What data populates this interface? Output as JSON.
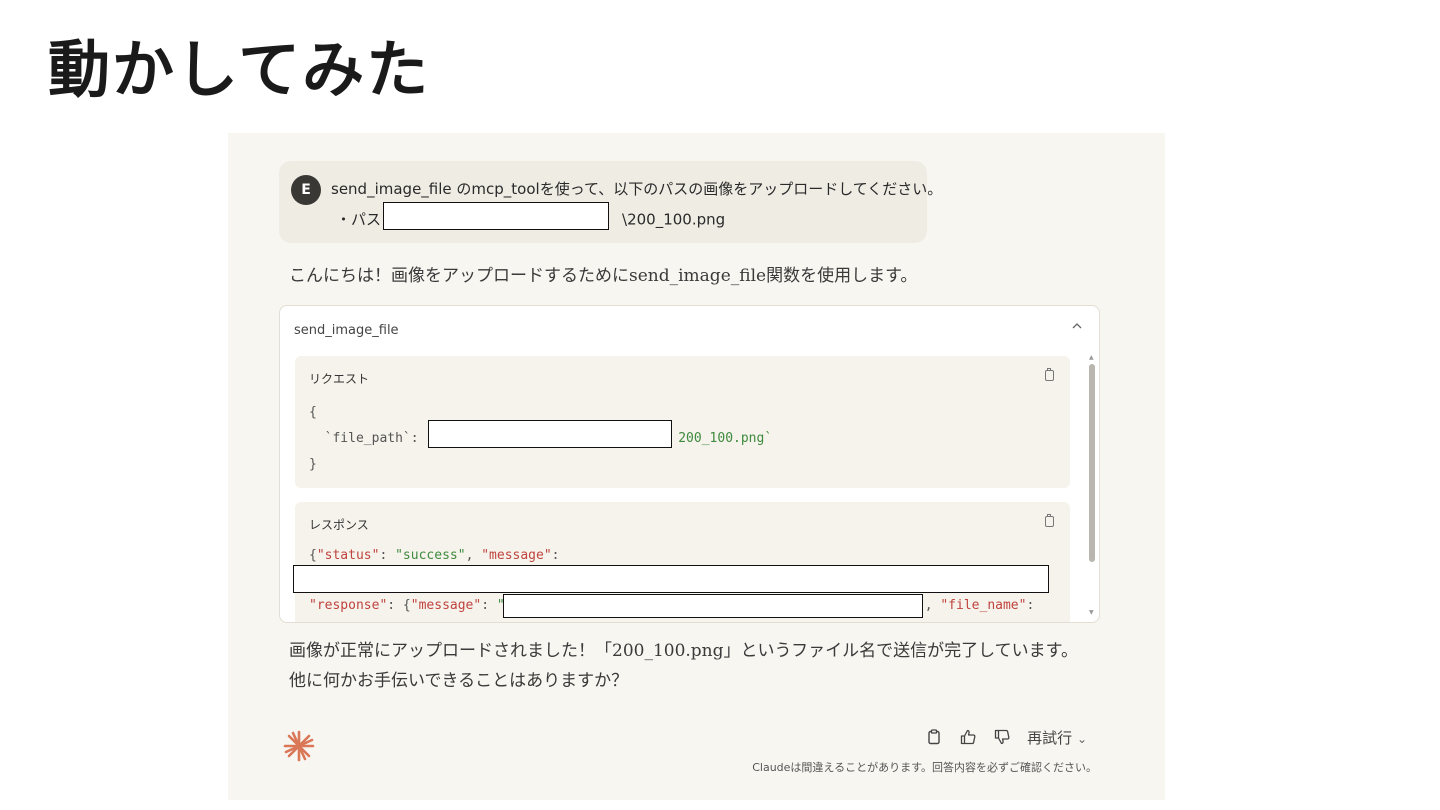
{
  "slide": {
    "title": "動かしてみた"
  },
  "chat": {
    "user_message": {
      "avatar_letter": "E",
      "line1": "send_image_file のmcp_toolを使って、以下のパスの画像をアップロードしてください。",
      "line2_prefix": "・パス：",
      "line2_suffix": "\\200_100.png"
    },
    "assistant_intro": "こんにちは！画像をアップロードするためにsend_image_file関数を使用します。",
    "tool_call": {
      "name": "send_image_file",
      "request": {
        "label": "リクエスト",
        "open_brace": "{",
        "key": "`file_path`",
        "colon": ": ",
        "value_prefix": "`",
        "value_suffix": "200_100.png`",
        "close_brace": "}"
      },
      "response": {
        "label": "レスポンス",
        "line1_open": "{",
        "status_key": "\"status\"",
        "status_value": "\"success\"",
        "message_key": "\"message\"",
        "response_key": "\"response\"",
        "nested_open": ": {",
        "nested_message_key": "\"message\"",
        "nested_message_value_prefix": "\"",
        "file_name_key": "\"file_name\"",
        "separator": ", ",
        "colon": ": ",
        "trailing_colon": ":"
      }
    },
    "assistant_result": "画像が正常にアップロードされました！「200_100.png」というファイル名で送信が完了しています。他に何かお手伝いできることはありますか？",
    "actions": {
      "retry_label": "再試行",
      "retry_chevron": "⌄"
    },
    "disclaimer": "Claudeは間違えることがあります。回答内容を必ずご確認ください。"
  },
  "colors": {
    "background": "#f8f6f1",
    "user_bubble": "#efece4",
    "claude_accent": "#d97757",
    "string_green": "#3e8a3e",
    "key_red": "#c0433e"
  }
}
